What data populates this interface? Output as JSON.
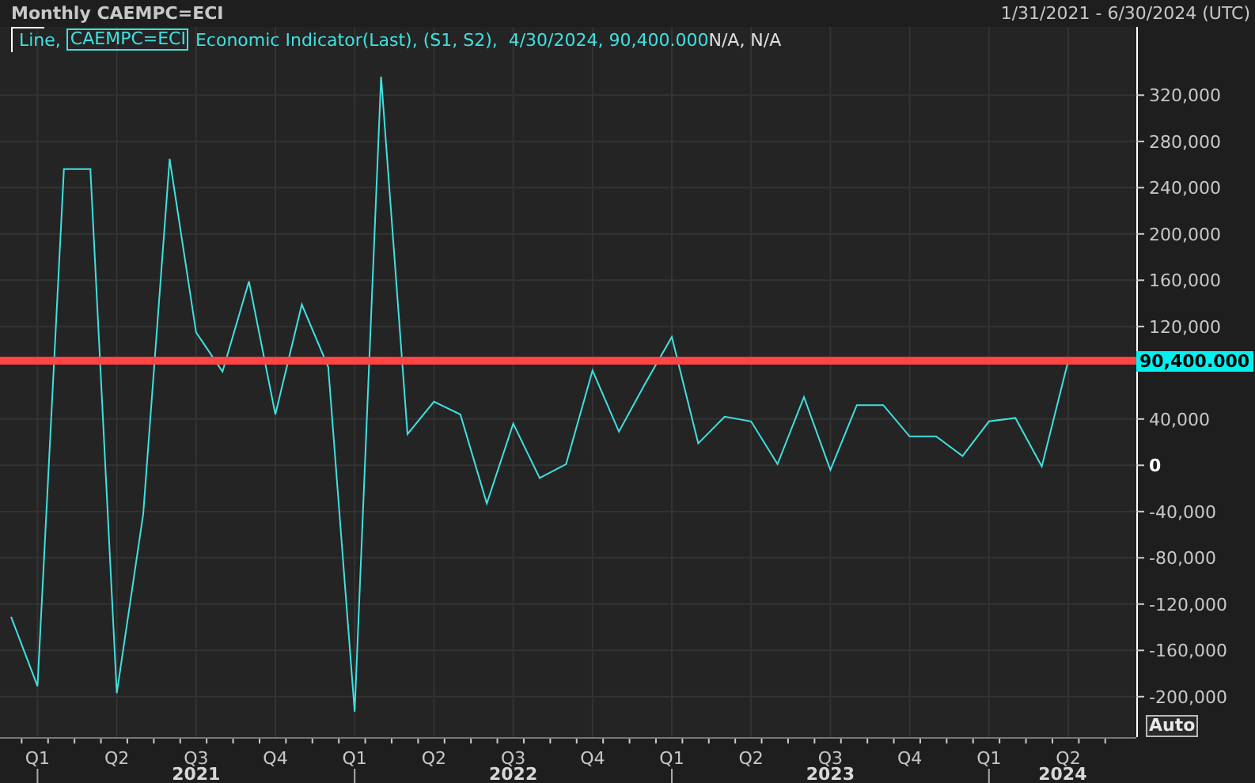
{
  "header": {
    "title": "Monthly CAEMPC=ECI",
    "date_range": "1/31/2021 - 6/30/2024 (UTC)"
  },
  "legend": {
    "prefix": "Line,",
    "description": "Economic Indicator(Last), (S1, S2),  4/30/2024, 90,400.000",
    "status": "N/A, N/A"
  },
  "chart_data": {
    "type": "line",
    "categories": [
      null,
      "Q1",
      null,
      null,
      "Q2",
      null,
      null,
      "Q3",
      null,
      null,
      "Q4",
      null,
      null,
      "Q1",
      null,
      null,
      "Q2",
      null,
      null,
      "Q3",
      null,
      null,
      "Q4",
      null,
      null,
      "Q1",
      null,
      null,
      "Q2",
      null,
      null,
      "Q3",
      null,
      null,
      "Q4",
      null,
      null,
      "Q1",
      null,
      null,
      "Q2"
    ],
    "grid": true,
    "series": [
      {
        "name": "CAEMPC=ECI",
        "color": "#40e0e0",
        "values": [
          -131000,
          -191000,
          256000,
          256000,
          -197000,
          -42000,
          265000,
          115000,
          81000,
          159000,
          44000,
          139000,
          85000,
          -213000,
          336000,
          27000,
          55000,
          44000,
          -33000,
          36000,
          -11000,
          1000,
          82000,
          29000,
          71000,
          111000,
          19000,
          42000,
          38000,
          1000,
          59000,
          -4000,
          52000,
          52000,
          25000,
          25000,
          8000,
          38000,
          41000,
          -1000,
          90400
        ]
      }
    ],
    "ylim": [
      -235000,
      379000
    ],
    "yticks": [
      {
        "value": 320000,
        "label": "320,000"
      },
      {
        "value": 280000,
        "label": "280,000"
      },
      {
        "value": 240000,
        "label": "240,000"
      },
      {
        "value": 200000,
        "label": "200,000"
      },
      {
        "value": 160000,
        "label": "160,000"
      },
      {
        "value": 120000,
        "label": "120,000"
      },
      {
        "value": 40000,
        "label": "40,000"
      },
      {
        "value": 0,
        "label": "0"
      },
      {
        "value": -40000,
        "label": "-40,000"
      },
      {
        "value": -80000,
        "label": "-80,000"
      },
      {
        "value": -120000,
        "label": "-120,000"
      },
      {
        "value": -160000,
        "label": "-160,000"
      },
      {
        "value": -200000,
        "label": "-200,000"
      }
    ],
    "ref_lines": [
      {
        "axis": "y",
        "value": 90400,
        "label": "90,400.000",
        "color": "#ff4444"
      }
    ]
  },
  "x_axis_years": [
    "2021",
    "2022",
    "2023",
    "2024"
  ],
  "scale_button": "Auto"
}
